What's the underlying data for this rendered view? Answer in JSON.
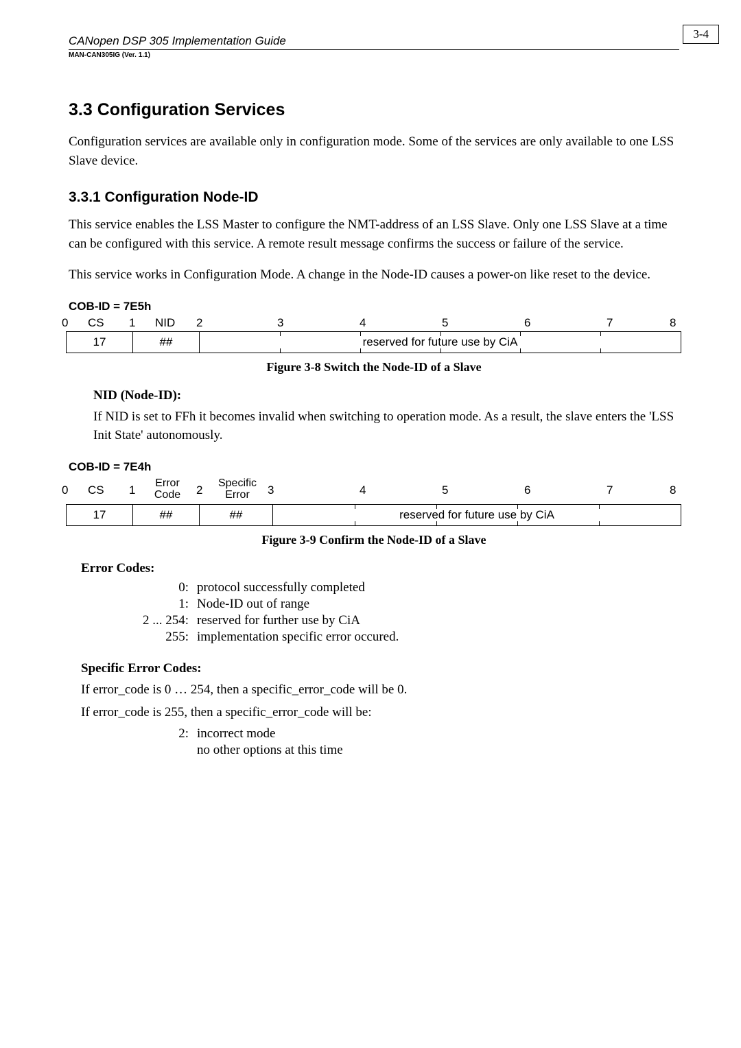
{
  "header": {
    "title": "CANopen DSP 305 Implementation Guide",
    "sub": "MAN-CAN305IG (Ver. 1.1)",
    "page_number": "3-4"
  },
  "sec33": {
    "num_title": "3.3    Configuration Services",
    "p1": "Configuration services are available only in configuration mode. Some of the services are only available to one LSS Slave device."
  },
  "sec331": {
    "num_title": "3.3.1   Configuration Node-ID",
    "p1": "This service enables the LSS Master to configure the NMT-address of an LSS Slave. Only one LSS Slave at a time can be configured with this  service.  A remote result message confirms the success or failure of the service.",
    "p2": "This service works in Configuration Mode. A change in the Node-ID causes a power-on like reset to the device."
  },
  "cob1": {
    "label": "COB-ID = 7E5h",
    "headers": [
      "0",
      "CS",
      "1",
      "NID",
      "2",
      "3",
      "4",
      "5",
      "6",
      "7",
      "8"
    ],
    "row_cs": "17",
    "row_nid": "##",
    "row_reserved": "reserved for future use by CiA",
    "caption": "Figure 3-8  Switch the Node-ID of a Slave"
  },
  "nid_block": {
    "label": "NID (Node-ID):",
    "text": "If NID is set to FFh it becomes invalid when switching to operation mode. As a result, the slave enters the 'LSS Init State' autonomously."
  },
  "cob2": {
    "label": "COB-ID = 7E4h",
    "h_nums": [
      "0",
      "1",
      "2",
      "3",
      "4",
      "5",
      "6",
      "7",
      "8"
    ],
    "h_cs": "CS",
    "h_err_top": "Error",
    "h_err_bot": "Code",
    "h_sp_top": "Specific",
    "h_sp_bot": "Error",
    "row_cs": "17",
    "row_err": "##",
    "row_sp": "##",
    "row_reserved": "reserved for future use by CiA",
    "caption": "Figure 3-9  Confirm the Node-ID of a Slave"
  },
  "errcodes": {
    "label": "Error Codes:",
    "items": [
      {
        "n": "0:",
        "t": "protocol successfully completed"
      },
      {
        "n": "1:",
        "t": "Node-ID out of range"
      },
      {
        "n": "2 ... 254:",
        "t": "reserved for further use by CiA"
      },
      {
        "n": "255:",
        "t": "implementation specific error occured."
      }
    ]
  },
  "spec": {
    "label": "Specific Error Codes:",
    "p1": "If error_code is 0 … 254, then a specific_error_code will be 0.",
    "p2": "If error_code is 255, then a specific_error_code will be:",
    "items": [
      {
        "n": "2:",
        "t": "incorrect mode"
      },
      {
        "n": "",
        "t": "no other options at this time"
      }
    ]
  }
}
